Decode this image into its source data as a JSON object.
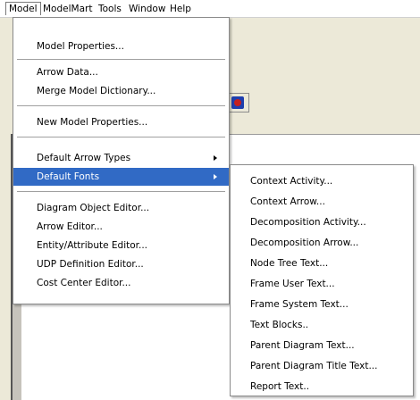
{
  "menubar": {
    "items": [
      "Model",
      "ModelMart",
      "Tools",
      "Window",
      "Help"
    ]
  },
  "model_menu": {
    "items": [
      {
        "label": "Model Properties..."
      },
      {
        "label": "Arrow Data..."
      },
      {
        "label": "Merge Model Dictionary..."
      },
      {
        "label": "New Model Properties..."
      },
      {
        "label": "Default Arrow Types",
        "submenu": true
      },
      {
        "label": "Default Fonts",
        "submenu": true,
        "highlighted": true
      },
      {
        "label": "Diagram Object Editor..."
      },
      {
        "label": "Arrow Editor..."
      },
      {
        "label": "Entity/Attribute Editor..."
      },
      {
        "label": "UDP Definition Editor..."
      },
      {
        "label": "Cost Center Editor..."
      }
    ]
  },
  "fonts_submenu": {
    "items": [
      {
        "label": "Context Activity..."
      },
      {
        "label": "Context Arrow..."
      },
      {
        "label": "Decomposition Activity..."
      },
      {
        "label": "Decomposition Arrow..."
      },
      {
        "label": "Node Tree Text..."
      },
      {
        "label": "Frame User Text..."
      },
      {
        "label": "Frame System Text..."
      },
      {
        "label": "Text Blocks.."
      },
      {
        "label": "Parent Diagram Text..."
      },
      {
        "label": "Parent Diagram Title Text..."
      },
      {
        "label": "Report Text.."
      }
    ]
  },
  "colors": {
    "highlight": "#316ac5",
    "menu_bg": "#ffffff",
    "window_bg": "#ece9d8"
  }
}
